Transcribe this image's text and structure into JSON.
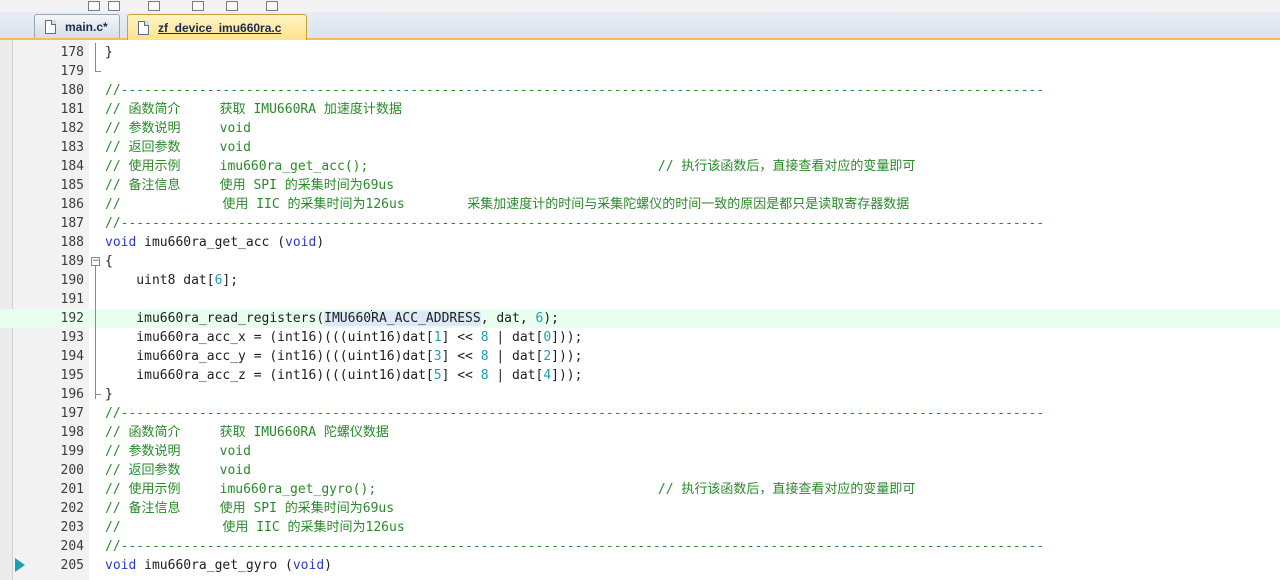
{
  "tabs": [
    {
      "label": "main.c*",
      "active": false
    },
    {
      "label": "zf_device_imu660ra.c",
      "active": true
    }
  ],
  "colors": {
    "comment": "#2a8a2a",
    "keyword": "#2a3ad1",
    "number": "#1aa0b3",
    "current_line_bg": "#e8fff0",
    "active_tab": "#fde48a"
  },
  "editor": {
    "current_line": 192,
    "bookmark_line": 205,
    "lines": [
      {
        "n": "178",
        "segs": [
          [
            "p",
            "}"
          ]
        ]
      },
      {
        "n": "179",
        "segs": []
      },
      {
        "n": "180",
        "segs": [
          [
            "c",
            "//----------------------------------------------------------------------------------------------------------------------"
          ]
        ]
      },
      {
        "n": "181",
        "segs": [
          [
            "c",
            "// 函数简介     获取 IMU660RA 加速度计数据"
          ]
        ]
      },
      {
        "n": "182",
        "segs": [
          [
            "c",
            "// 参数说明     void"
          ]
        ]
      },
      {
        "n": "183",
        "segs": [
          [
            "c",
            "// 返回参数     void"
          ]
        ]
      },
      {
        "n": "184",
        "segs": [
          [
            "c",
            "// 使用示例     imu660ra_get_acc();                                     // 执行该函数后，直接查看对应的变量即可"
          ]
        ]
      },
      {
        "n": "185",
        "segs": [
          [
            "c",
            "// 备注信息     使用 SPI 的采集时间为69us"
          ]
        ]
      },
      {
        "n": "186",
        "segs": [
          [
            "c",
            "//             使用 IIC 的采集时间为126us        采集加速度计的时间与采集陀螺仪的时间一致的原因是都只是读取寄存器数据"
          ]
        ]
      },
      {
        "n": "187",
        "segs": [
          [
            "c",
            "//----------------------------------------------------------------------------------------------------------------------"
          ]
        ]
      },
      {
        "n": "188",
        "segs": [
          [
            "k",
            "void"
          ],
          [
            "p",
            " imu660ra_get_acc ("
          ],
          [
            "k",
            "void"
          ],
          [
            "p",
            ")"
          ]
        ]
      },
      {
        "n": "189",
        "segs": [
          [
            "p",
            "{"
          ]
        ]
      },
      {
        "n": "190",
        "segs": [
          [
            "p",
            "    uint8 dat["
          ],
          [
            "d",
            "6"
          ],
          [
            "p",
            "];"
          ]
        ]
      },
      {
        "n": "191",
        "segs": []
      },
      {
        "n": "192",
        "segs": [
          [
            "p",
            "    imu660ra_read_registers("
          ],
          [
            "s",
            "IMU660"
          ],
          [
            "caret",
            ""
          ],
          [
            "s",
            "RA_ACC_ADDRESS"
          ],
          [
            "p",
            ", dat, "
          ],
          [
            "d",
            "6"
          ],
          [
            "p",
            ");"
          ]
        ]
      },
      {
        "n": "193",
        "segs": [
          [
            "p",
            "    imu660ra_acc_x = (int16)(((uint16)dat["
          ],
          [
            "d",
            "1"
          ],
          [
            "p",
            "] << "
          ],
          [
            "d",
            "8"
          ],
          [
            "p",
            " | dat["
          ],
          [
            "d",
            "0"
          ],
          [
            "p",
            "]));"
          ]
        ]
      },
      {
        "n": "194",
        "segs": [
          [
            "p",
            "    imu660ra_acc_y = (int16)(((uint16)dat["
          ],
          [
            "d",
            "3"
          ],
          [
            "p",
            "] << "
          ],
          [
            "d",
            "8"
          ],
          [
            "p",
            " | dat["
          ],
          [
            "d",
            "2"
          ],
          [
            "p",
            "]));"
          ]
        ]
      },
      {
        "n": "195",
        "segs": [
          [
            "p",
            "    imu660ra_acc_z = (int16)(((uint16)dat["
          ],
          [
            "d",
            "5"
          ],
          [
            "p",
            "] << "
          ],
          [
            "d",
            "8"
          ],
          [
            "p",
            " | dat["
          ],
          [
            "d",
            "4"
          ],
          [
            "p",
            "]));"
          ]
        ]
      },
      {
        "n": "196",
        "segs": [
          [
            "p",
            "}"
          ]
        ]
      },
      {
        "n": "197",
        "segs": [
          [
            "c",
            "//----------------------------------------------------------------------------------------------------------------------"
          ]
        ]
      },
      {
        "n": "198",
        "segs": [
          [
            "c",
            "// 函数简介     获取 IMU660RA 陀螺仪数据"
          ]
        ]
      },
      {
        "n": "199",
        "segs": [
          [
            "c",
            "// 参数说明     void"
          ]
        ]
      },
      {
        "n": "200",
        "segs": [
          [
            "c",
            "// 返回参数     void"
          ]
        ]
      },
      {
        "n": "201",
        "segs": [
          [
            "c",
            "// 使用示例     imu660ra_get_gyro();                                    // 执行该函数后，直接查看对应的变量即可"
          ]
        ]
      },
      {
        "n": "202",
        "segs": [
          [
            "c",
            "// 备注信息     使用 SPI 的采集时间为69us"
          ]
        ]
      },
      {
        "n": "203",
        "segs": [
          [
            "c",
            "//             使用 IIC 的采集时间为126us"
          ]
        ]
      },
      {
        "n": "204",
        "segs": [
          [
            "c",
            "//----------------------------------------------------------------------------------------------------------------------"
          ]
        ]
      },
      {
        "n": "205",
        "segs": [
          [
            "k",
            "void"
          ],
          [
            "p",
            " imu660ra_get_gyro ("
          ],
          [
            "k",
            "void"
          ],
          [
            "p",
            ")"
          ]
        ]
      }
    ]
  }
}
